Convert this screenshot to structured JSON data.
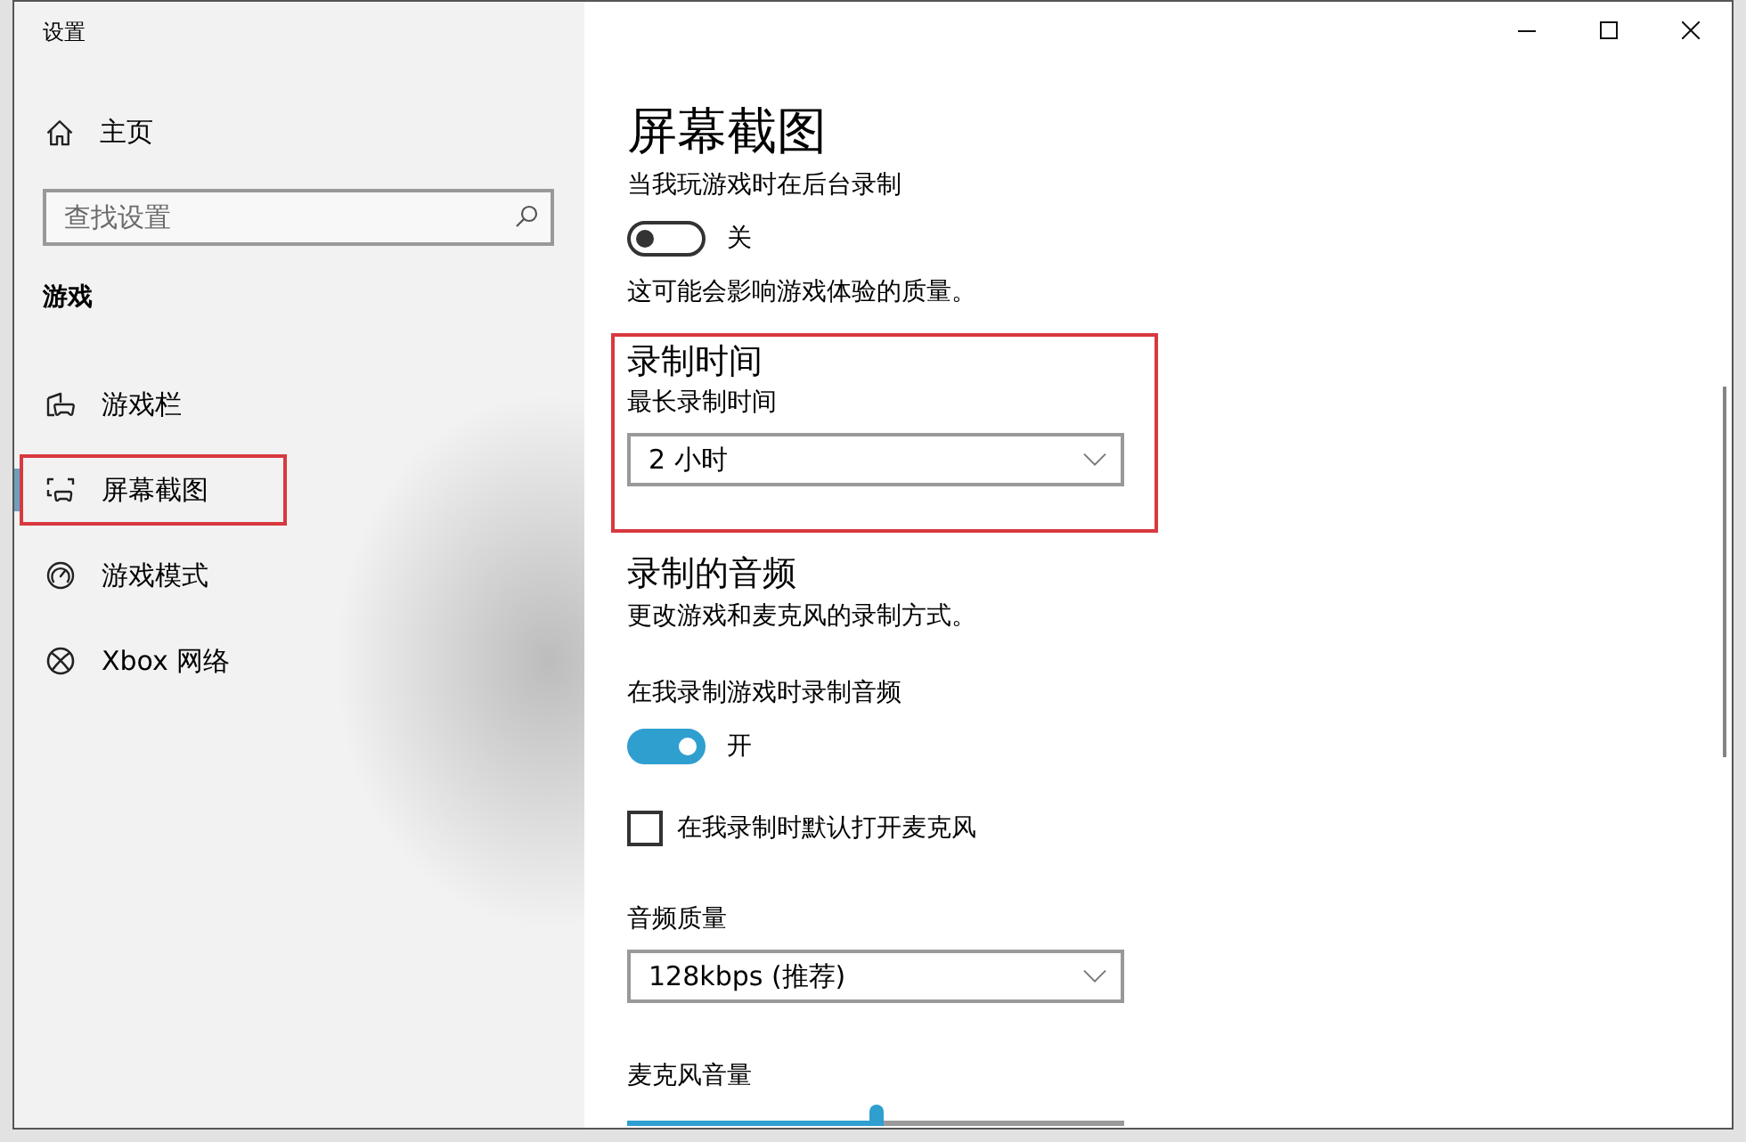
{
  "window": {
    "title": "设置"
  },
  "sidebar": {
    "home": {
      "label": "主页"
    },
    "search": {
      "placeholder": "查找设置"
    },
    "section_title": "游戏",
    "items": [
      {
        "label": "游戏栏",
        "selected": false,
        "highlighted": false
      },
      {
        "label": "屏幕截图",
        "selected": true,
        "highlighted": true
      },
      {
        "label": "游戏模式",
        "selected": false,
        "highlighted": false
      },
      {
        "label": "Xbox 网络",
        "selected": false,
        "highlighted": false
      }
    ]
  },
  "content": {
    "title": "屏幕截图",
    "groups": [
      {
        "highlighted": false,
        "items": [
          {
            "kind": "toggle",
            "label": "当我玩游戏时在后台录制",
            "on": false,
            "state_text": "关"
          },
          {
            "kind": "note",
            "text": "这可能会影响游戏体验的质量。"
          }
        ]
      },
      {
        "heading": "录制时间",
        "highlighted": true,
        "items": [
          {
            "kind": "dropdown",
            "label": "最长录制时间",
            "value": "2 小时"
          }
        ]
      },
      {
        "heading": "录制的音频",
        "description": "更改游戏和麦克风的录制方式。",
        "highlighted": false,
        "items": [
          {
            "kind": "toggle",
            "label": "在我录制游戏时录制音频",
            "on": true,
            "state_text": "开"
          },
          {
            "kind": "checkbox",
            "label": "在我录制时默认打开麦克风",
            "checked": false
          },
          {
            "kind": "dropdown",
            "label": "音频质量",
            "value": "128kbps (推荐)"
          },
          {
            "kind": "slider",
            "label": "麦克风音量",
            "level": 0.5
          }
        ]
      }
    ]
  }
}
